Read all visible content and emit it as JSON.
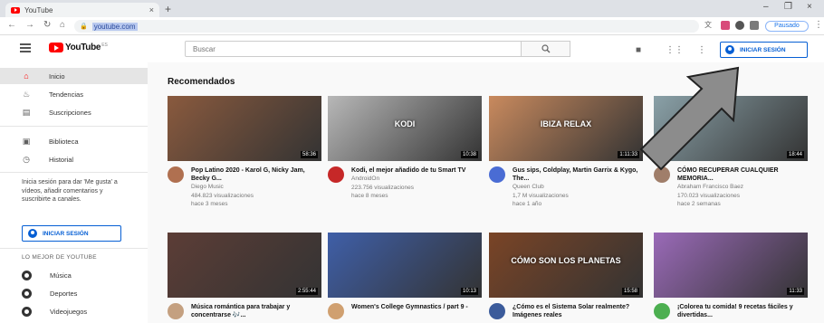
{
  "browser": {
    "tab_title": "YouTube",
    "tab_close": "×",
    "new_tab": "+",
    "url": "youtube.com",
    "window_controls": [
      "–",
      "❐",
      "×"
    ],
    "profile_label": "Pausado"
  },
  "header": {
    "logo_text": "YouTube",
    "logo_country": "ES",
    "search_placeholder": "Buscar",
    "signin_label": "INICIAR SESIÓN"
  },
  "sidebar": {
    "items": [
      {
        "label": "Inicio",
        "icon": "home-icon"
      },
      {
        "label": "Tendencias",
        "icon": "flame-icon"
      },
      {
        "label": "Suscripciones",
        "icon": "subscriptions-icon"
      },
      {
        "label": "Biblioteca",
        "icon": "library-icon"
      },
      {
        "label": "Historial",
        "icon": "history-icon"
      }
    ],
    "note": "Inicia sesión para dar 'Me gusta' a vídeos, añadir comentarios y suscribirte a canales.",
    "signin_label": "INICIAR SESIÓN",
    "best_heading": "LO MEJOR DE YOUTUBE",
    "categories": [
      {
        "label": "Música"
      },
      {
        "label": "Deportes"
      },
      {
        "label": "Videojuegos"
      }
    ]
  },
  "main": {
    "section_title": "Recomendados",
    "videos": [
      {
        "title": "Pop Latino 2020 - Karol G, Nicky Jam, Becky G...",
        "channel": "Diego Music",
        "views": "484.823 visualizaciones",
        "age": "hace 3 meses",
        "duration": "58:36",
        "thumb_color": "#8a5a3e",
        "avatar_color": "#b07050"
      },
      {
        "title": "Kodi, el mejor añadido de tu Smart TV",
        "channel": "AndroidOn",
        "views": "223.756 visualizaciones",
        "age": "hace 8 meses",
        "duration": "10:38",
        "thumb_color": "#b8b8b8",
        "avatar_color": "#c62828",
        "thumb_text": "KODI"
      },
      {
        "title": "Gus sips, Coldplay, Martin Garrix & Kygo, The...",
        "channel": "Queen Club",
        "views": "1,7 M visualizaciones",
        "age": "hace 1 año",
        "duration": "1:11:33",
        "thumb_color": "#c98a5e",
        "avatar_color": "#4a6cd4",
        "thumb_text": "IBIZA RELAX"
      },
      {
        "title": "CÓMO RECUPERAR CUALQUIER MEMORIA...",
        "channel": "Abraham Francisco Baez",
        "views": "170.023 visualizaciones",
        "age": "hace 2 semanas",
        "duration": "18:44",
        "thumb_color": "#8aa1a8",
        "avatar_color": "#a07e6a"
      },
      {
        "title": "Música romántica para trabajar y concentrarse 🎶...",
        "channel": "",
        "views": "",
        "age": "",
        "duration": "2:55:44",
        "thumb_color": "#5c3d36",
        "avatar_color": "#c4a080"
      },
      {
        "title": "Women's College Gymnastics / part 9 -",
        "channel": "",
        "views": "",
        "age": "",
        "duration": "10:13",
        "thumb_color": "#3f5fa8",
        "avatar_color": "#d0a070"
      },
      {
        "title": "¿Cómo es el Sistema Solar realmente? Imágenes reales",
        "channel": "",
        "views": "",
        "age": "",
        "duration": "15:58",
        "thumb_color": "#7a4426",
        "avatar_color": "#3b5b9b",
        "thumb_text": "CÓMO SON LOS PLANETAS"
      },
      {
        "title": "¡Colorea tu comida! 9 recetas fáciles y divertidas...",
        "channel": "",
        "views": "",
        "age": "",
        "duration": "11:33",
        "thumb_color": "#9a6ab8",
        "avatar_color": "#4caf50"
      }
    ]
  },
  "colors": {
    "youtube_red": "#ff0000",
    "link_blue": "#065fd4",
    "sidebar_active": "#e5e5e5"
  }
}
